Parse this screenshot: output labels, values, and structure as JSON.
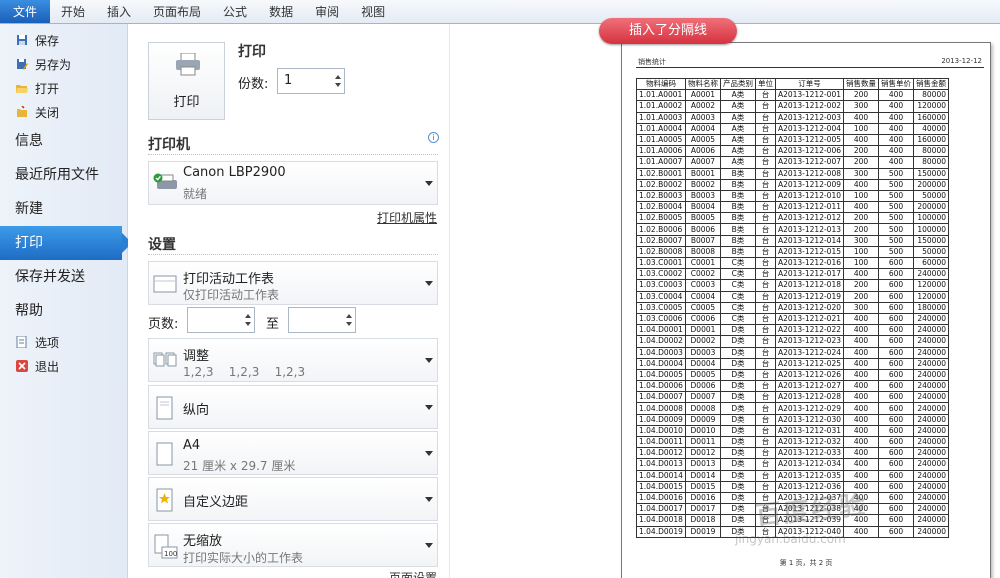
{
  "ribbon": {
    "tabs": [
      "文件",
      "开始",
      "插入",
      "页面布局",
      "公式",
      "数据",
      "审阅",
      "视图"
    ]
  },
  "nav": {
    "top_items": [
      {
        "label": "保存",
        "icon": "save-icon"
      },
      {
        "label": "另存为",
        "icon": "save-as-icon"
      },
      {
        "label": "打开",
        "icon": "open-folder-icon"
      },
      {
        "label": "关闭",
        "icon": "close-file-icon"
      }
    ],
    "big_items": [
      "信息",
      "最近所用文件",
      "新建",
      "打印",
      "保存并发送",
      "帮助"
    ],
    "active": "打印",
    "bottom_items": [
      {
        "label": "选项",
        "icon": "options-icon"
      },
      {
        "label": "退出",
        "icon": "exit-icon"
      }
    ]
  },
  "print": {
    "button_label": "打印",
    "title": "打印",
    "copies_label": "份数:",
    "copies_value": "1"
  },
  "printer": {
    "section_title": "打印机",
    "name": "Canon LBP2900",
    "status": "就绪",
    "properties_link": "打印机属性"
  },
  "settings": {
    "section_title": "设置",
    "scope": {
      "main": "打印活动工作表",
      "sub": "仅打印活动工作表"
    },
    "pages_label": "页数:",
    "pages_to": "至",
    "collate": {
      "main": "调整",
      "sub": "1,2,3    1,2,3    1,2,3"
    },
    "orientation": {
      "main": "纵向"
    },
    "paper": {
      "main": "A4",
      "sub": "21 厘米 x 29.7 厘米"
    },
    "margins": {
      "main": "自定义边距"
    },
    "scaling": {
      "main": "无缩放",
      "sub": "打印实际大小的工作表"
    },
    "page_setup_link": "页面设置"
  },
  "preview": {
    "header_left": "销售统计",
    "header_right": "2013-12-12",
    "callout": "插入了分隔线",
    "footer": "第 1 页，共 2 页",
    "watermark": "百度经验",
    "watermark_sub": "jingyan.baidu.com",
    "columns": [
      "物料编码",
      "物料名称",
      "产品类别",
      "单位",
      "订单号",
      "销售数量",
      "销售单价",
      "销售金额"
    ],
    "rows": [
      [
        "1.01.A0001",
        "A0001",
        "A类",
        "台",
        "A2013-1212-001",
        "200",
        "400",
        "80000"
      ],
      [
        "1.01.A0002",
        "A0002",
        "A类",
        "台",
        "A2013-1212-002",
        "300",
        "400",
        "120000"
      ],
      [
        "1.01.A0003",
        "A0003",
        "A类",
        "台",
        "A2013-1212-003",
        "400",
        "400",
        "160000"
      ],
      [
        "1.01.A0004",
        "A0004",
        "A类",
        "台",
        "A2013-1212-004",
        "100",
        "400",
        "40000"
      ],
      [
        "1.01.A0005",
        "A0005",
        "A类",
        "台",
        "A2013-1212-005",
        "400",
        "400",
        "160000"
      ],
      [
        "1.01.A0006",
        "A0006",
        "A类",
        "台",
        "A2013-1212-006",
        "200",
        "400",
        "80000"
      ],
      [
        "1.01.A0007",
        "A0007",
        "A类",
        "台",
        "A2013-1212-007",
        "200",
        "400",
        "80000"
      ],
      [
        "1.02.B0001",
        "B0001",
        "B类",
        "台",
        "A2013-1212-008",
        "300",
        "500",
        "150000"
      ],
      [
        "1.02.B0002",
        "B0002",
        "B类",
        "台",
        "A2013-1212-009",
        "400",
        "500",
        "200000"
      ],
      [
        "1.02.B0003",
        "B0003",
        "B类",
        "台",
        "A2013-1212-010",
        "100",
        "500",
        "50000"
      ],
      [
        "1.02.B0004",
        "B0004",
        "B类",
        "台",
        "A2013-1212-011",
        "400",
        "500",
        "200000"
      ],
      [
        "1.02.B0005",
        "B0005",
        "B类",
        "台",
        "A2013-1212-012",
        "200",
        "500",
        "100000"
      ],
      [
        "1.02.B0006",
        "B0006",
        "B类",
        "台",
        "A2013-1212-013",
        "200",
        "500",
        "100000"
      ],
      [
        "1.02.B0007",
        "B0007",
        "B类",
        "台",
        "A2013-1212-014",
        "300",
        "500",
        "150000"
      ],
      [
        "1.02.B0008",
        "B0008",
        "B类",
        "台",
        "A2013-1212-015",
        "100",
        "500",
        "50000"
      ],
      [
        "1.03.C0001",
        "C0001",
        "C类",
        "台",
        "A2013-1212-016",
        "100",
        "600",
        "60000"
      ],
      [
        "1.03.C0002",
        "C0002",
        "C类",
        "台",
        "A2013-1212-017",
        "400",
        "600",
        "240000"
      ],
      [
        "1.03.C0003",
        "C0003",
        "C类",
        "台",
        "A2013-1212-018",
        "200",
        "600",
        "120000"
      ],
      [
        "1.03.C0004",
        "C0004",
        "C类",
        "台",
        "A2013-1212-019",
        "200",
        "600",
        "120000"
      ],
      [
        "1.03.C0005",
        "C0005",
        "C类",
        "台",
        "A2013-1212-020",
        "300",
        "600",
        "180000"
      ],
      [
        "1.03.C0006",
        "C0006",
        "C类",
        "台",
        "A2013-1212-021",
        "400",
        "600",
        "240000"
      ],
      [
        "1.04.D0001",
        "D0001",
        "D类",
        "台",
        "A2013-1212-022",
        "400",
        "600",
        "240000"
      ],
      [
        "1.04.D0002",
        "D0002",
        "D类",
        "台",
        "A2013-1212-023",
        "400",
        "600",
        "240000"
      ],
      [
        "1.04.D0003",
        "D0003",
        "D类",
        "台",
        "A2013-1212-024",
        "400",
        "600",
        "240000"
      ],
      [
        "1.04.D0004",
        "D0004",
        "D类",
        "台",
        "A2013-1212-025",
        "400",
        "600",
        "240000"
      ],
      [
        "1.04.D0005",
        "D0005",
        "D类",
        "台",
        "A2013-1212-026",
        "400",
        "600",
        "240000"
      ],
      [
        "1.04.D0006",
        "D0006",
        "D类",
        "台",
        "A2013-1212-027",
        "400",
        "600",
        "240000"
      ],
      [
        "1.04.D0007",
        "D0007",
        "D类",
        "台",
        "A2013-1212-028",
        "400",
        "600",
        "240000"
      ],
      [
        "1.04.D0008",
        "D0008",
        "D类",
        "台",
        "A2013-1212-029",
        "400",
        "600",
        "240000"
      ],
      [
        "1.04.D0009",
        "D0009",
        "D类",
        "台",
        "A2013-1212-030",
        "400",
        "600",
        "240000"
      ],
      [
        "1.04.D0010",
        "D0010",
        "D类",
        "台",
        "A2013-1212-031",
        "400",
        "600",
        "240000"
      ],
      [
        "1.04.D0011",
        "D0011",
        "D类",
        "台",
        "A2013-1212-032",
        "400",
        "600",
        "240000"
      ],
      [
        "1.04.D0012",
        "D0012",
        "D类",
        "台",
        "A2013-1212-033",
        "400",
        "600",
        "240000"
      ],
      [
        "1.04.D0013",
        "D0013",
        "D类",
        "台",
        "A2013-1212-034",
        "400",
        "600",
        "240000"
      ],
      [
        "1.04.D0014",
        "D0014",
        "D类",
        "台",
        "A2013-1212-035",
        "400",
        "600",
        "240000"
      ],
      [
        "1.04.D0015",
        "D0015",
        "D类",
        "台",
        "A2013-1212-036",
        "400",
        "600",
        "240000"
      ],
      [
        "1.04.D0016",
        "D0016",
        "D类",
        "台",
        "A2013-1212-037",
        "400",
        "600",
        "240000"
      ],
      [
        "1.04.D0017",
        "D0017",
        "D类",
        "台",
        "A2013-1212-038",
        "400",
        "600",
        "240000"
      ],
      [
        "1.04.D0018",
        "D0018",
        "D类",
        "台",
        "A2013-1212-039",
        "400",
        "600",
        "240000"
      ],
      [
        "1.04.D0019",
        "D0019",
        "D类",
        "台",
        "A2013-1212-040",
        "400",
        "600",
        "240000"
      ]
    ]
  },
  "colors": {
    "accent": "#1e6cc5",
    "callout": "#d6323f"
  }
}
